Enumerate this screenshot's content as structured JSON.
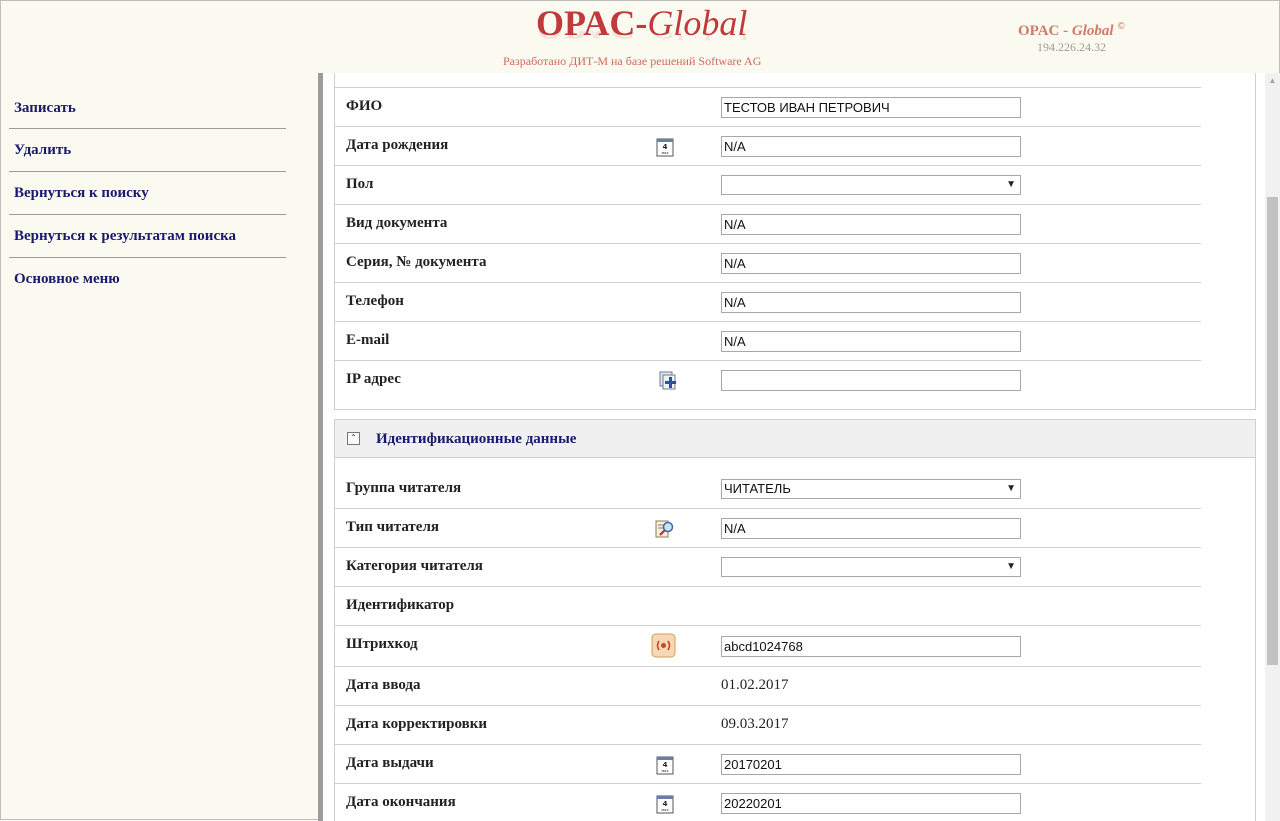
{
  "header": {
    "logo_main": "OPAC-",
    "logo_italic": "Global",
    "subtitle": "Разработано ДИТ-М на базе решений Software AG",
    "brand_main": "OPAC - ",
    "brand_italic": "Global",
    "brand_copy": "©",
    "ip": "194.226.24.32"
  },
  "sidebar": {
    "items": [
      {
        "label": "Записать"
      },
      {
        "label": "Удалить"
      },
      {
        "label": "Вернуться к поиску"
      },
      {
        "label": "Вернуться к результатам поиска"
      },
      {
        "label": "Основное меню"
      }
    ]
  },
  "personal": {
    "rows": [
      {
        "label": "ФИО",
        "value": "ТЕСТОВ ИВАН ПЕТРОВИЧ"
      },
      {
        "label": "Дата рождения",
        "value": "N/A",
        "icon": "calendar-icon"
      },
      {
        "label": "Пол",
        "value": ""
      },
      {
        "label": "Вид документа",
        "value": "N/A"
      },
      {
        "label": "Серия, № документа",
        "value": "N/A"
      },
      {
        "label": "Телефон",
        "value": "N/A"
      },
      {
        "label": "E-mail",
        "value": "N/A"
      },
      {
        "label": "IP адрес",
        "value": "",
        "icon": "add-ip-icon"
      }
    ]
  },
  "identification": {
    "title": "Идентификационные данные",
    "rows": [
      {
        "label": "Группа читателя",
        "value": "ЧИТАТЕЛЬ"
      },
      {
        "label": "Тип читателя",
        "value": "N/A",
        "icon": "search-icon"
      },
      {
        "label": "Категория читателя",
        "value": ""
      },
      {
        "label": "Идентификатор"
      },
      {
        "label": "Штрихкод",
        "value": "abcd1024768",
        "icon": "barcode-scanner-icon"
      },
      {
        "label": "Дата ввода",
        "value": "01.02.2017"
      },
      {
        "label": "Дата корректировки",
        "value": "09.03.2017"
      },
      {
        "label": "Дата выдачи",
        "value": "20170201",
        "icon": "calendar-icon"
      },
      {
        "label": "Дата окончания",
        "value": "20220201",
        "icon": "calendar-icon"
      }
    ]
  },
  "icons": {
    "calendar_day": "4",
    "calendar_month": "мая"
  },
  "colors": {
    "logo": "#c0393b",
    "nav_text": "#1a1a6e",
    "background": "#fbfaf1"
  }
}
